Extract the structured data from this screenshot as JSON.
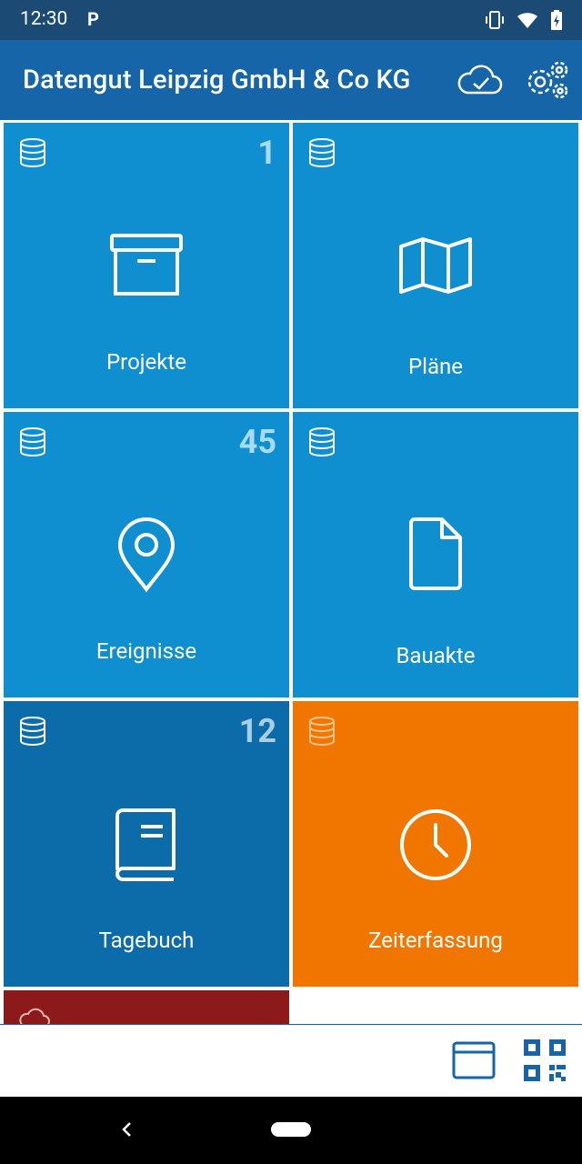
{
  "status": {
    "time": "12:30",
    "carrier_icon": "P"
  },
  "app": {
    "title": "Datengut Leipzig GmbH & Co KG"
  },
  "tiles": [
    {
      "label": "Projekte",
      "count": "1",
      "icon": "archive-box-icon"
    },
    {
      "label": "Pläne",
      "count": "",
      "icon": "map-icon"
    },
    {
      "label": "Ereignisse",
      "count": "45",
      "icon": "location-pin-icon"
    },
    {
      "label": "Bauakte",
      "count": "",
      "icon": "document-icon"
    },
    {
      "label": "Tagebuch",
      "count": "12",
      "icon": "book-icon"
    },
    {
      "label": "Zeiterfassung",
      "count": "",
      "icon": "clock-icon"
    }
  ],
  "colors": {
    "status": "#1b4a75",
    "appbar": "#1565a8",
    "tile": "#0f8ed0",
    "tile_dark": "#0b6ca9",
    "orange": "#f07600",
    "red": "#8c1a1a"
  }
}
